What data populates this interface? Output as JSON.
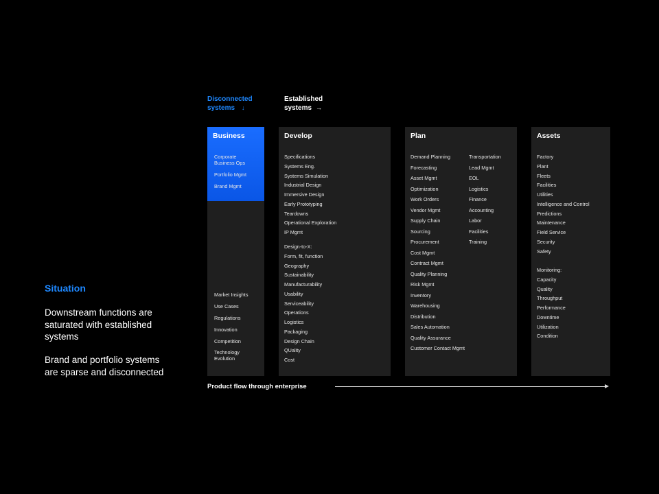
{
  "situation": {
    "title": "Situation",
    "lines": [
      "Downstream functions are",
      "saturated with established",
      "systems",
      "Brand and portfolio systems",
      "are sparse and disconnected"
    ]
  },
  "headers": {
    "disconnected": [
      "Disconnected",
      "systems"
    ],
    "established": [
      "Established",
      "systems"
    ],
    "down_arrow": "↓",
    "right_arrow": "→"
  },
  "business": {
    "title": "Business",
    "top_items": [
      "Corporate Business Ops",
      "Portfolio Mgmt",
      "Brand Mgmt"
    ],
    "bottom_items": [
      "Market Insights",
      "Use Cases",
      "Regulations",
      "Innovation",
      "Competition",
      "Technology Evolution"
    ],
    "highlight_color": "#1a6dff"
  },
  "develop": {
    "title": "Develop",
    "items": [
      "Specifications",
      "Systems Eng.",
      "Systems Simulation",
      "Industrial Design",
      "Immersive Design",
      "Early Prototyping",
      "Teardowns",
      "Operational Exploration",
      "IP Mgmt"
    ],
    "design_items": [
      "Design-to-X:",
      "Form, fit, function",
      "Geography",
      "Sustainability",
      "Manufacturability",
      "Usability",
      "Serviceability",
      "Operations",
      "Logistics",
      "Packaging",
      "Design Chain",
      "QUality",
      "Cost"
    ]
  },
  "plan": {
    "title": "Plan",
    "col1": [
      "Demand Planning",
      "Forecasting",
      "Asset Mgmt",
      "Optimization",
      "Work Orders",
      "Vendor Mgmt",
      "Supply Chain",
      "Sourcing",
      "Procurement",
      "Cost Mgmt",
      "Contract Mgmt",
      "Quality Planning",
      "Risk Mgmt",
      "Inventory",
      "Warehousing",
      "Distribution",
      "Sales Automation",
      "Quality Assurance",
      "Customer Contact Mgmt"
    ],
    "col2": [
      "Transportation",
      "Lead Mgmt",
      "EOL",
      "Logistics",
      "Finance",
      "Accounting",
      "Labor",
      "Facilities",
      "Training"
    ]
  },
  "assets": {
    "title": "Assets",
    "items": [
      "Factory",
      "Plant",
      "Fleets",
      "Facilities",
      "Utilities",
      "Intelligence and Control",
      "Predictions",
      "Maintenance",
      "Field Service",
      "Security",
      "Safety"
    ],
    "monitoring_items": [
      "Monitoring:",
      "Capacity",
      "Quality",
      "Throughput",
      "Performance",
      "Downtime",
      "Utilization",
      "Condition"
    ]
  },
  "flow": {
    "label": "Product flow through enterprise"
  },
  "colors": {
    "accent": "#1e88ff",
    "panel": "#1f1f1f",
    "background": "#000000"
  }
}
